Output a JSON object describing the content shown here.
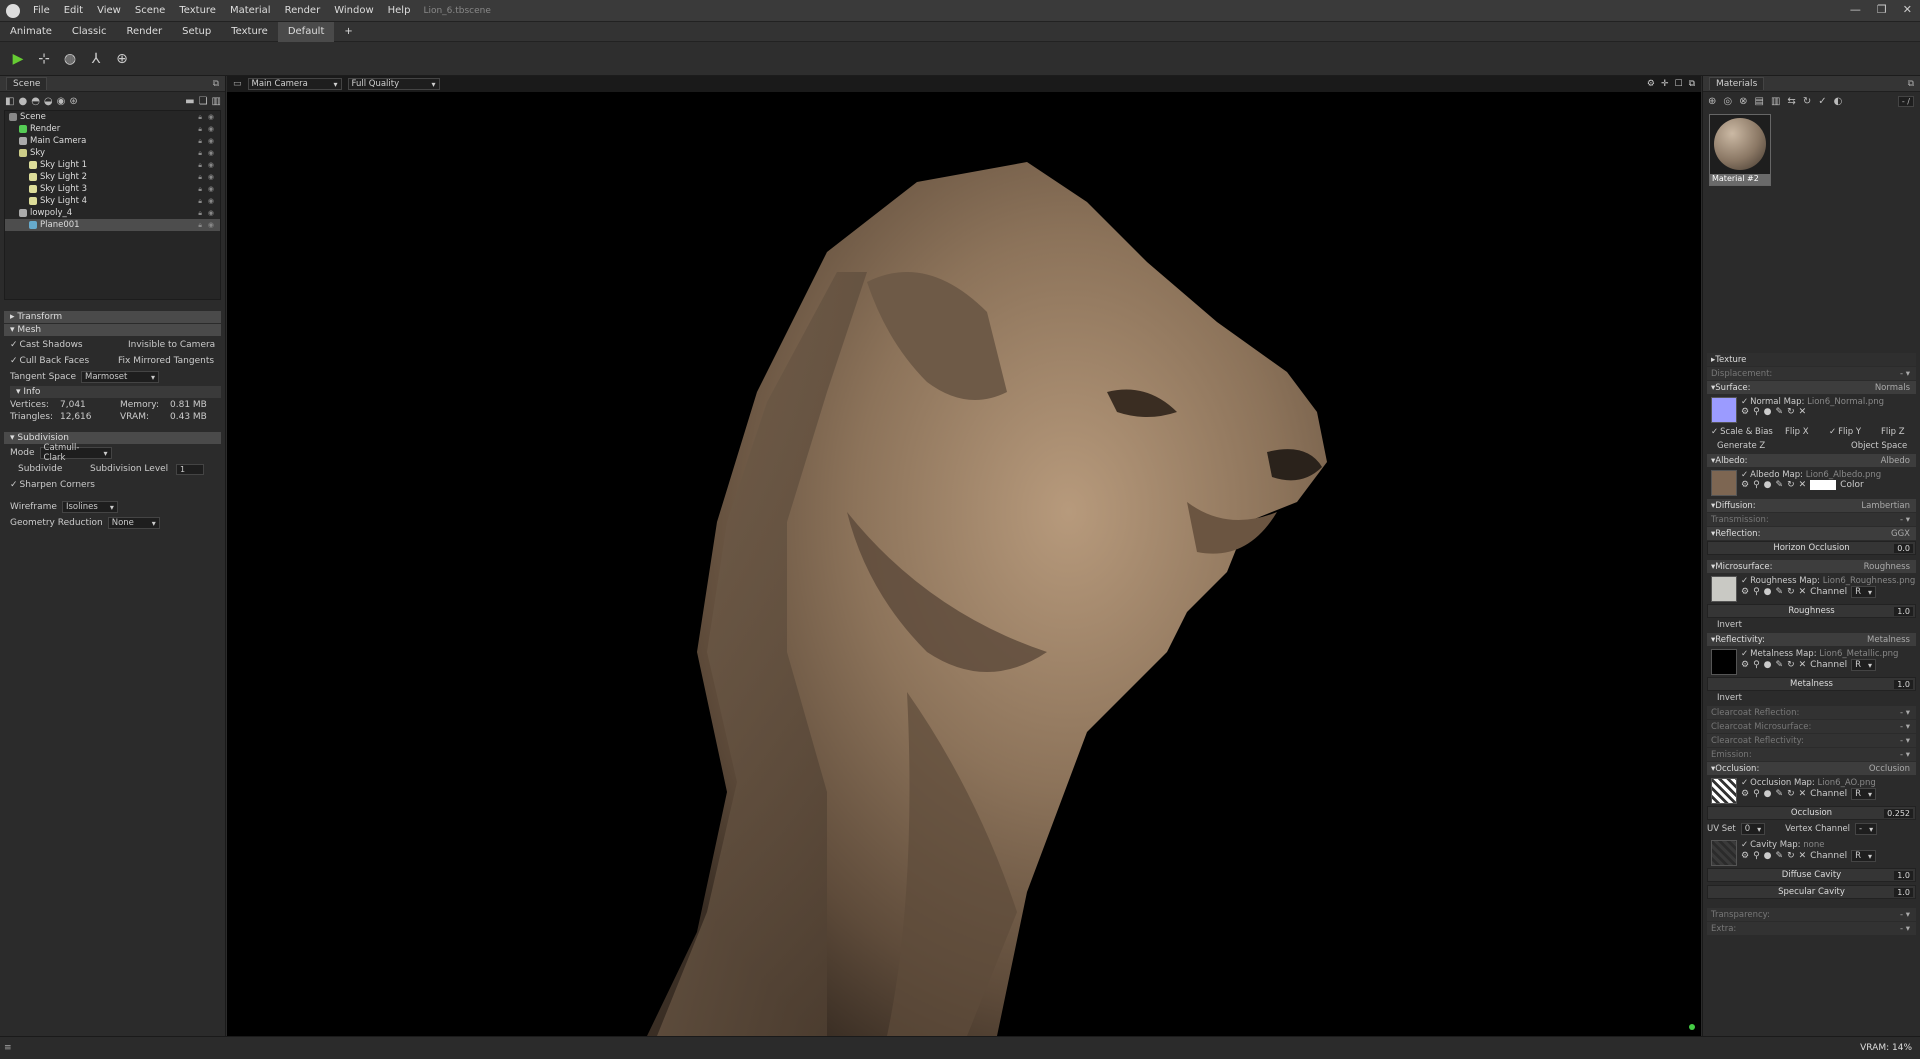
{
  "app": {
    "file_name": "Lion_6.tbscene"
  },
  "menu": [
    "File",
    "Edit",
    "View",
    "Scene",
    "Texture",
    "Material",
    "Render",
    "Window",
    "Help"
  ],
  "tabs": [
    "Animate",
    "Classic",
    "Render",
    "Setup",
    "Texture",
    "Default",
    "+"
  ],
  "scene": {
    "tab": "Scene",
    "tree": [
      {
        "label": "Scene",
        "indent": 0,
        "color": "#888"
      },
      {
        "label": "Render",
        "indent": 1,
        "color": "#5c5"
      },
      {
        "label": "Main Camera",
        "indent": 1,
        "color": "#aaa"
      },
      {
        "label": "Sky",
        "indent": 1,
        "color": "#cc8"
      },
      {
        "label": "Sky Light 1",
        "indent": 2,
        "color": "#dd9"
      },
      {
        "label": "Sky Light 2",
        "indent": 2,
        "color": "#dd9"
      },
      {
        "label": "Sky Light 3",
        "indent": 2,
        "color": "#dd9"
      },
      {
        "label": "Sky Light 4",
        "indent": 2,
        "color": "#dd9"
      },
      {
        "label": "lowpoly_4",
        "indent": 1,
        "color": "#aaa"
      },
      {
        "label": "Plane001",
        "indent": 2,
        "color": "#6ac",
        "selected": true
      }
    ]
  },
  "props": {
    "transform": "Transform",
    "mesh": "Mesh",
    "cast_shadows": "Cast Shadows",
    "invisible_to_camera": "Invisible to Camera",
    "cull_back_faces": "Cull Back Faces",
    "fix_mirrored_tangents": "Fix Mirrored Tangents",
    "tangent_space_label": "Tangent Space",
    "tangent_space_value": "Marmoset",
    "info": "Info",
    "vertices_label": "Vertices:",
    "vertices": "7,041",
    "memory_label": "Memory:",
    "memory": "0.81 MB",
    "triangles_label": "Triangles:",
    "triangles": "12,616",
    "vram_label": "VRAM:",
    "vram": "0.43 MB",
    "subdivision": "Subdivision",
    "mode_label": "Mode",
    "mode_value": "Catmull-Clark",
    "subdivide": "Subdivide",
    "subdivision_level_label": "Subdivision Level",
    "subdivision_level": "1",
    "sharpen_corners": "Sharpen Corners",
    "wireframe_label": "Wireframe",
    "wireframe_value": "Isolines",
    "geometry_reduction_label": "Geometry Reduction",
    "geometry_reduction_value": "None"
  },
  "viewport": {
    "camera": "Main Camera",
    "quality": "Full Quality"
  },
  "materials": {
    "tab": "Materials",
    "counter": "- /",
    "material_name": "Material #2",
    "texture": "Texture",
    "displacement": "Displacement:",
    "surface": "Surface:",
    "surface_mode": "Normals",
    "normal_map_label": "Normal Map:",
    "normal_map": "Lion6_Normal.png",
    "scale_bias": "Scale & Bias",
    "flip_x": "Flip X",
    "flip_y": "Flip Y",
    "flip_z": "Flip Z",
    "generate_z": "Generate Z",
    "object_space": "Object Space",
    "albedo": "Albedo:",
    "albedo_mode": "Albedo",
    "albedo_map_label": "Albedo Map:",
    "albedo_map": "Lion6_Albedo.png",
    "color": "Color",
    "diffusion": "Diffusion:",
    "diffusion_mode": "Lambertian",
    "transmission": "Transmission:",
    "reflection": "Reflection:",
    "reflection_mode": "GGX",
    "horizon_occlusion": "Horizon Occlusion",
    "horizon_occlusion_value": "0.0",
    "microsurface": "Microsurface:",
    "microsurface_mode": "Roughness",
    "roughness_map_label": "Roughness Map:",
    "roughness_map": "Lion6_Roughness.png",
    "channel": "Channel",
    "channel_value": "R",
    "roughness": "Roughness",
    "roughness_value": "1.0",
    "invert": "Invert",
    "reflectivity": "Reflectivity:",
    "reflectivity_mode": "Metalness",
    "metalness_map_label": "Metalness Map:",
    "metalness_map": "Lion6_Metallic.png",
    "metalness": "Metalness",
    "metalness_value": "1.0",
    "clearcoat_reflection": "Clearcoat Reflection:",
    "clearcoat_microsurface": "Clearcoat Microsurface:",
    "clearcoat_reflectivity": "Clearcoat Reflectivity:",
    "emission": "Emission:",
    "occlusion": "Occlusion:",
    "occlusion_mode": "Occlusion",
    "occlusion_map_label": "Occlusion Map:",
    "occlusion_map": "Lion6_AO.png",
    "occlusion_label": "Occlusion",
    "occlusion_value": "0.252",
    "uv_set": "UV Set",
    "uv_set_value": "0",
    "vertex_channel": "Vertex Channel",
    "vertex_channel_value": "-",
    "cavity_map_label": "Cavity Map:",
    "cavity_map": "none",
    "diffuse_cavity": "Diffuse Cavity",
    "diffuse_cavity_value": "1.0",
    "specular_cavity": "Specular Cavity",
    "specular_cavity_value": "1.0",
    "transparency": "Transparency:",
    "extra": "Extra:"
  },
  "status": {
    "vram": "VRAM: 14%"
  }
}
